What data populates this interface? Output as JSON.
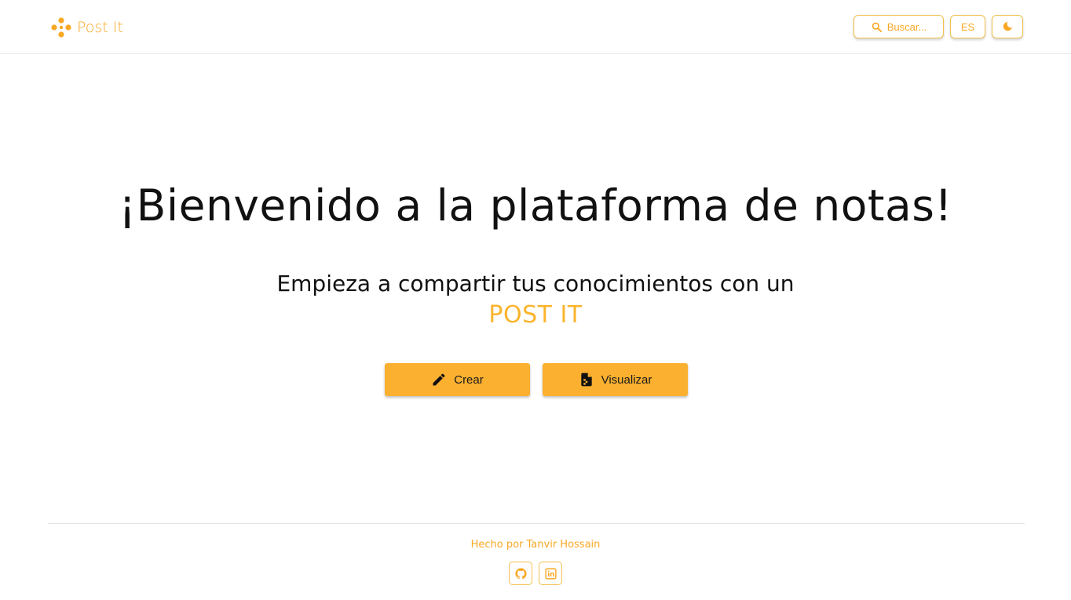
{
  "colors": {
    "accent": "#f9a825",
    "button_fill": "#fbb030",
    "text": "#111111"
  },
  "header": {
    "brand_name": "Post It",
    "brand_icon": "dots-logo-icon",
    "search_label": "Buscar...",
    "search_icon": "search-icon",
    "language_label": "ES",
    "theme_icon": "moon-icon"
  },
  "hero": {
    "title": "¡Bienvenido a la plataforma de notas!",
    "subtitle": "Empieza a compartir tus conocimientos con un",
    "brand_highlight": "POST IT"
  },
  "actions": {
    "create_label": "Crear",
    "create_icon": "pencil-icon",
    "view_label": "Visualizar",
    "view_icon": "note-icon"
  },
  "footer": {
    "credit": "Hecho por Tanvir Hossain",
    "links": [
      {
        "icon": "github-icon"
      },
      {
        "icon": "linkedin-icon"
      }
    ]
  }
}
